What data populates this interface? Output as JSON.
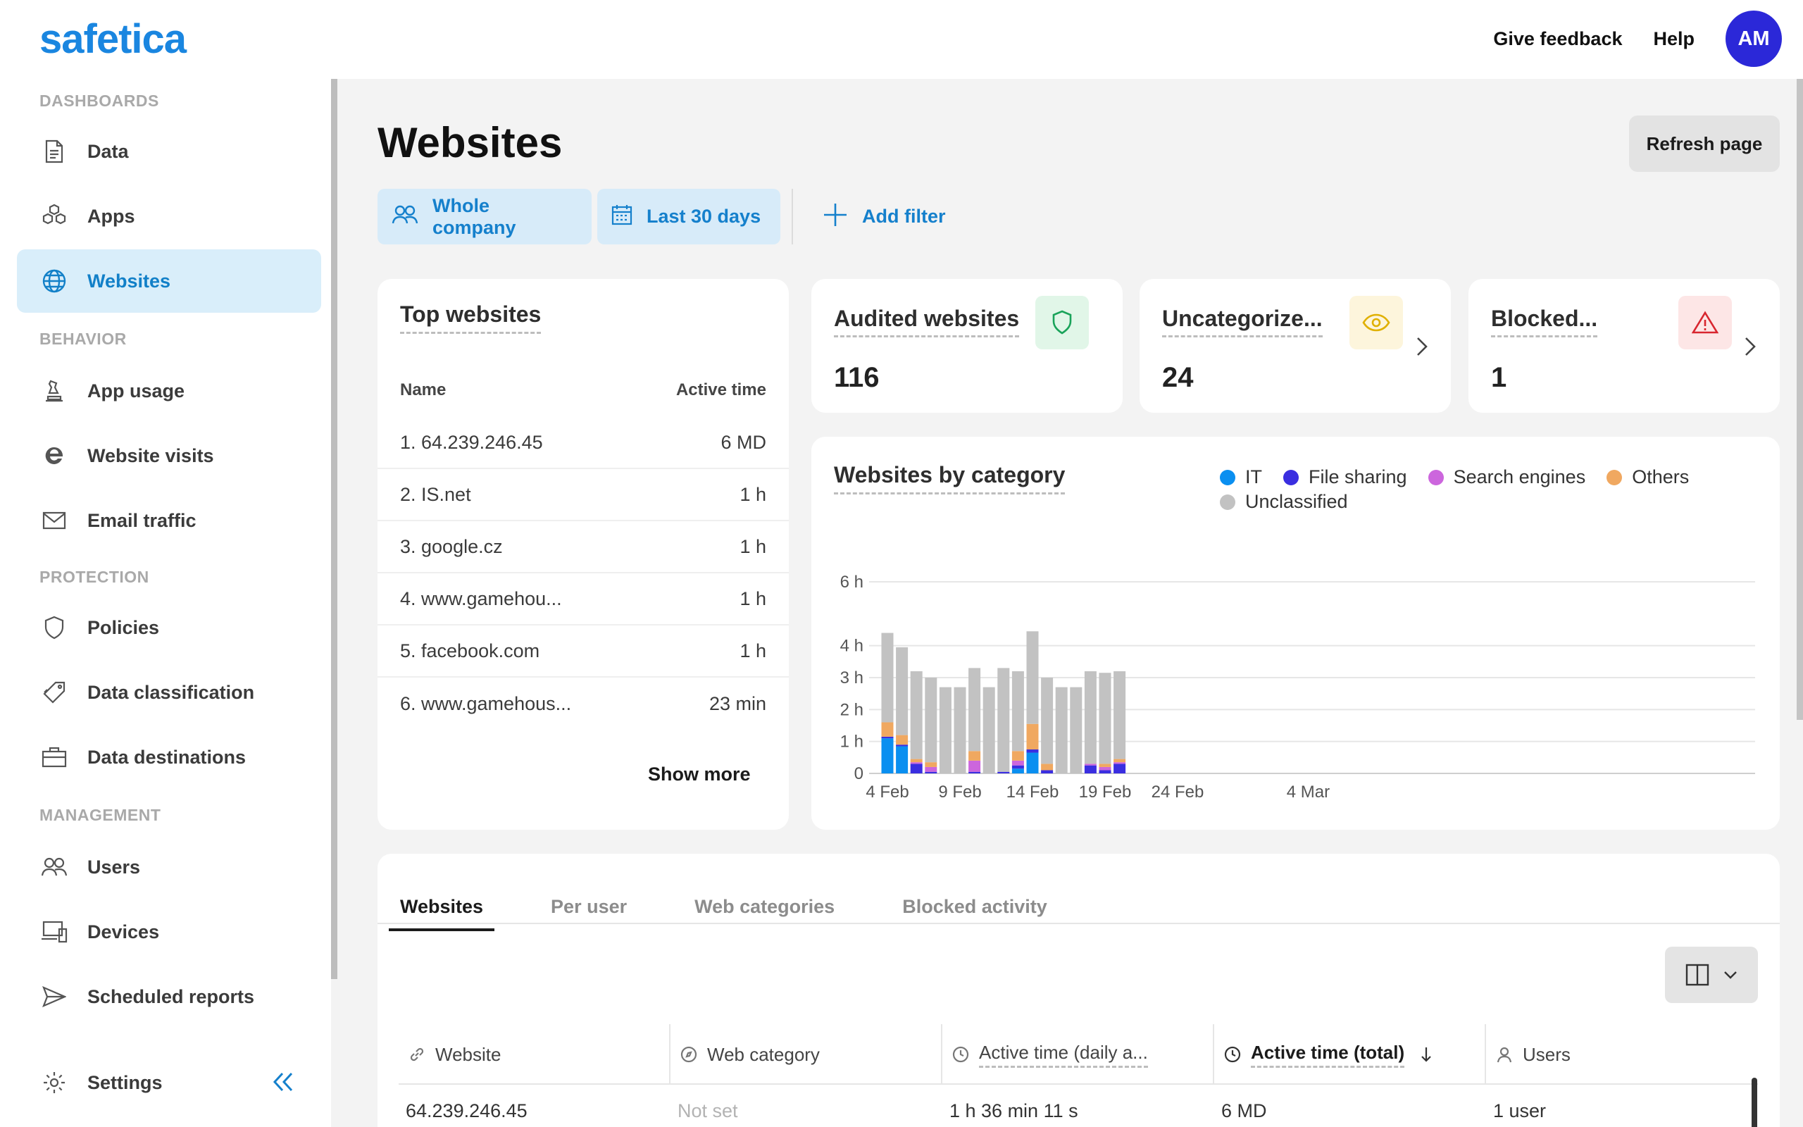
{
  "app": {
    "logo": "safetica"
  },
  "topbar": {
    "feedback_label": "Give feedback",
    "help_label": "Help",
    "avatar_initials": "AM",
    "avatar_color": "#2b28d8"
  },
  "sidebar": {
    "sections": [
      {
        "label": "DASHBOARDS",
        "items": [
          {
            "label": "Data",
            "icon": "document-icon"
          },
          {
            "label": "Apps",
            "icon": "cubes-icon"
          },
          {
            "label": "Websites",
            "icon": "globe-icon",
            "active": true
          }
        ]
      },
      {
        "label": "BEHAVIOR",
        "items": [
          {
            "label": "App usage",
            "icon": "chess-icon"
          },
          {
            "label": "Website visits",
            "icon": "browser-e-icon"
          },
          {
            "label": "Email traffic",
            "icon": "envelope-icon"
          }
        ]
      },
      {
        "label": "PROTECTION",
        "items": [
          {
            "label": "Policies",
            "icon": "shield-icon"
          },
          {
            "label": "Data classification",
            "icon": "tag-icon"
          },
          {
            "label": "Data destinations",
            "icon": "briefcase-icon"
          }
        ]
      },
      {
        "label": "MANAGEMENT",
        "items": [
          {
            "label": "Users",
            "icon": "users-icon"
          },
          {
            "label": "Devices",
            "icon": "devices-icon"
          },
          {
            "label": "Scheduled reports",
            "icon": "send-icon"
          }
        ]
      }
    ],
    "settings_label": "Settings"
  },
  "main": {
    "title": "Websites",
    "refresh_label": "Refresh page",
    "filters": {
      "scope": "Whole company",
      "period": "Last 30 days",
      "add_filter": "Add filter"
    }
  },
  "top_websites": {
    "title": "Top websites",
    "col_name": "Name",
    "col_time": "Active time",
    "rows": [
      {
        "name": "1. 64.239.246.45",
        "time": "6 MD"
      },
      {
        "name": "2. IS.net",
        "time": "1 h"
      },
      {
        "name": "3. google.cz",
        "time": "1 h"
      },
      {
        "name": "4. www.gamehou...",
        "time": "1 h"
      },
      {
        "name": "5. facebook.com",
        "time": "1 h"
      },
      {
        "name": "6. www.gamehous...",
        "time": "23 min"
      }
    ],
    "show_more": "Show more"
  },
  "stats": {
    "audited": {
      "title": "Audited websites",
      "value": "116",
      "icon": "shield-check-icon",
      "color": "#1aa35a",
      "bg": "#e1f6e8"
    },
    "uncategorized": {
      "title": "Uncategorize...",
      "value": "24",
      "icon": "eye-icon",
      "color": "#e0b000",
      "bg": "#fdf5dc"
    },
    "blocked": {
      "title": "Blocked...",
      "value": "1",
      "icon": "warning-icon",
      "color": "#d8262f",
      "bg": "#fde6e6"
    }
  },
  "category_chart": {
    "title": "Websites by category",
    "legend": [
      {
        "name": "IT",
        "color": "#0a8ff0"
      },
      {
        "name": "File sharing",
        "color": "#3a2ee0"
      },
      {
        "name": "Search engines",
        "color": "#cc66dd"
      },
      {
        "name": "Others",
        "color": "#f0a860"
      },
      {
        "name": "Unclassified",
        "color": "#c2c2c2"
      }
    ]
  },
  "chart_data": {
    "type": "bar",
    "stacked": true,
    "title": "Websites by category",
    "y_unit": "h",
    "y_ticks": [
      "0",
      "1 h",
      "2 h",
      "3 h",
      "4 h",
      "6 h"
    ],
    "y_tick_values": [
      0,
      1,
      2,
      3,
      4,
      6
    ],
    "x_ticks": [
      "4 Feb",
      "9 Feb",
      "14 Feb",
      "19 Feb",
      "24 Feb",
      "4 Mar"
    ],
    "x_tick_days": [
      0,
      5,
      10,
      15,
      20,
      29
    ],
    "categories": [
      "4 Feb",
      "5 Feb",
      "6 Feb",
      "7 Feb",
      "8 Feb",
      "9 Feb",
      "10 Feb",
      "11 Feb",
      "12 Feb",
      "13 Feb",
      "14 Feb",
      "15 Feb",
      "16 Feb",
      "17 Feb",
      "18 Feb",
      "19 Feb",
      "20 Feb"
    ],
    "series": [
      {
        "name": "IT",
        "values": [
          1.1,
          0.85,
          0,
          0,
          0,
          0,
          0,
          0,
          0,
          0.15,
          0.65,
          0,
          0,
          0,
          0,
          0,
          0
        ]
      },
      {
        "name": "File sharing",
        "values": [
          0.05,
          0.05,
          0.3,
          0.05,
          0,
          0,
          0.05,
          0,
          0.05,
          0.1,
          0.1,
          0.1,
          0,
          0,
          0.25,
          0.1,
          0.3
        ]
      },
      {
        "name": "Search engines",
        "values": [
          0,
          0,
          0.05,
          0.15,
          0,
          0,
          0.35,
          0,
          0,
          0.15,
          0,
          0,
          0,
          0,
          0.05,
          0.1,
          0.05
        ]
      },
      {
        "name": "Others",
        "values": [
          0.45,
          0.3,
          0.1,
          0.15,
          0,
          0,
          0.3,
          0,
          0,
          0.3,
          0.8,
          0.2,
          0,
          0,
          0,
          0.1,
          0.1
        ]
      },
      {
        "name": "Unclassified",
        "values": [
          2.8,
          2.75,
          2.75,
          2.65,
          2.7,
          2.7,
          2.6,
          2.7,
          3.25,
          2.5,
          2.9,
          2.7,
          2.7,
          2.7,
          2.9,
          2.85,
          2.75
        ]
      }
    ],
    "ylim": [
      0,
      6
    ],
    "grid": true,
    "legend_position": "top-right"
  },
  "table": {
    "tabs": [
      {
        "label": "Websites",
        "active": true
      },
      {
        "label": "Per user"
      },
      {
        "label": "Web categories"
      },
      {
        "label": "Blocked activity"
      }
    ],
    "columns": [
      {
        "label": "Website",
        "icon": "link-icon"
      },
      {
        "label": "Web category",
        "icon": "compass-icon"
      },
      {
        "label": "Active time (daily a...",
        "icon": "clock-icon"
      },
      {
        "label": "Active time (total)",
        "icon": "clock-icon",
        "sorted": "desc"
      },
      {
        "label": "Users",
        "icon": "user-icon"
      }
    ],
    "rows": [
      {
        "website": "64.239.246.45",
        "category": "Not set",
        "daily": "1 h 36 min 11 s",
        "total": "6 MD",
        "users": "1 user"
      }
    ]
  }
}
